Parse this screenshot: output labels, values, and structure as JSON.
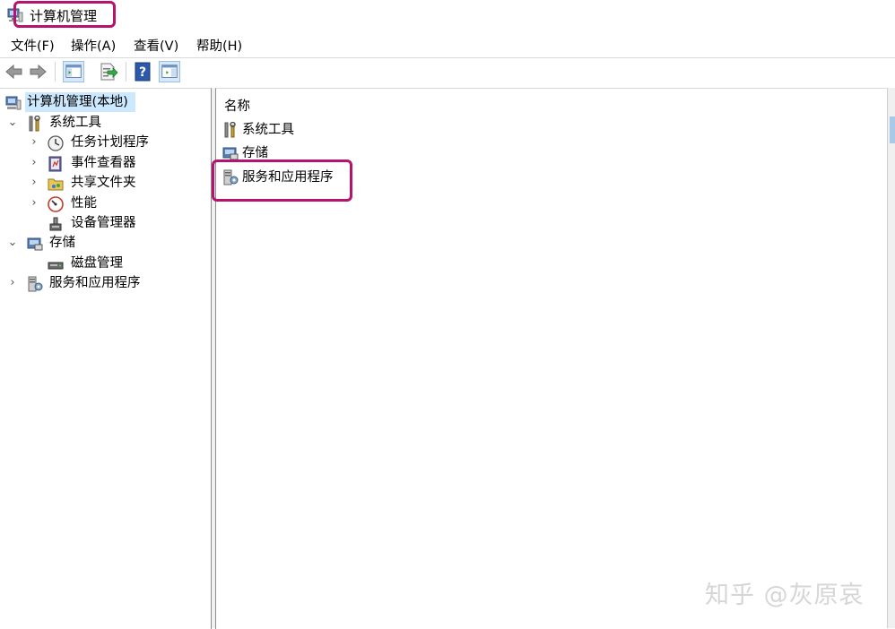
{
  "window": {
    "title": "计算机管理"
  },
  "menu": [
    "文件(F)",
    "操作(A)",
    "查看(V)",
    "帮助(H)"
  ],
  "toolbar": {
    "buttons": [
      "back-arrow-icon",
      "forward-arrow-icon",
      "show-tree-icon",
      "export-list-icon",
      "help-icon",
      "action-pane-icon"
    ]
  },
  "tree": {
    "root": "计算机管理(本地)",
    "system_tools": "系统工具",
    "task_scheduler": "任务计划程序",
    "event_viewer": "事件查看器",
    "shared_folders": "共享文件夹",
    "performance": "性能",
    "device_manager": "设备管理器",
    "storage": "存储",
    "disk_management": "磁盘管理",
    "services_apps": "服务和应用程序"
  },
  "list": {
    "header": "名称",
    "items": [
      "系统工具",
      "存储",
      "服务和应用程序"
    ]
  },
  "watermark": "知乎 @灰原哀",
  "colors": {
    "highlight_border": "#b5136d",
    "selection": "#cce8ff"
  }
}
